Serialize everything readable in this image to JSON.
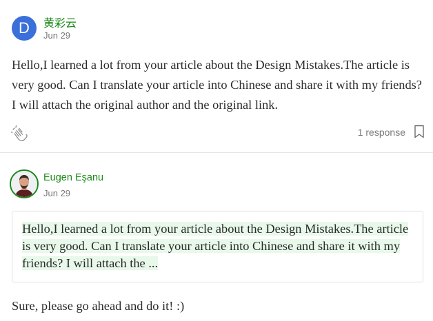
{
  "response1": {
    "avatar_letter": "D",
    "author": "黄彩云",
    "date": "Jun 29",
    "body": "Hello,I learned a lot from your article about the Design Mistakes.The article is very good. Can I translate your article into Chinese and share it with my friends? I will attach the original author and the original link.",
    "responses_count": "1 response",
    "icons": {
      "clap": "clap-icon",
      "bookmark": "bookmark-icon"
    }
  },
  "response2": {
    "author": "Eugen Eşanu",
    "date": "Jun 29",
    "quote": "Hello,I learned a lot from your article about the Design Mistakes.The article is very good. Can I translate your article into Chinese and share it with my friends? I will attach the ...",
    "reply": "Sure, please go ahead and do it! :)"
  },
  "colors": {
    "accent_green": "#1a8917",
    "avatar_blue": "#3b6fd9",
    "highlight": "#e8f8ea"
  }
}
